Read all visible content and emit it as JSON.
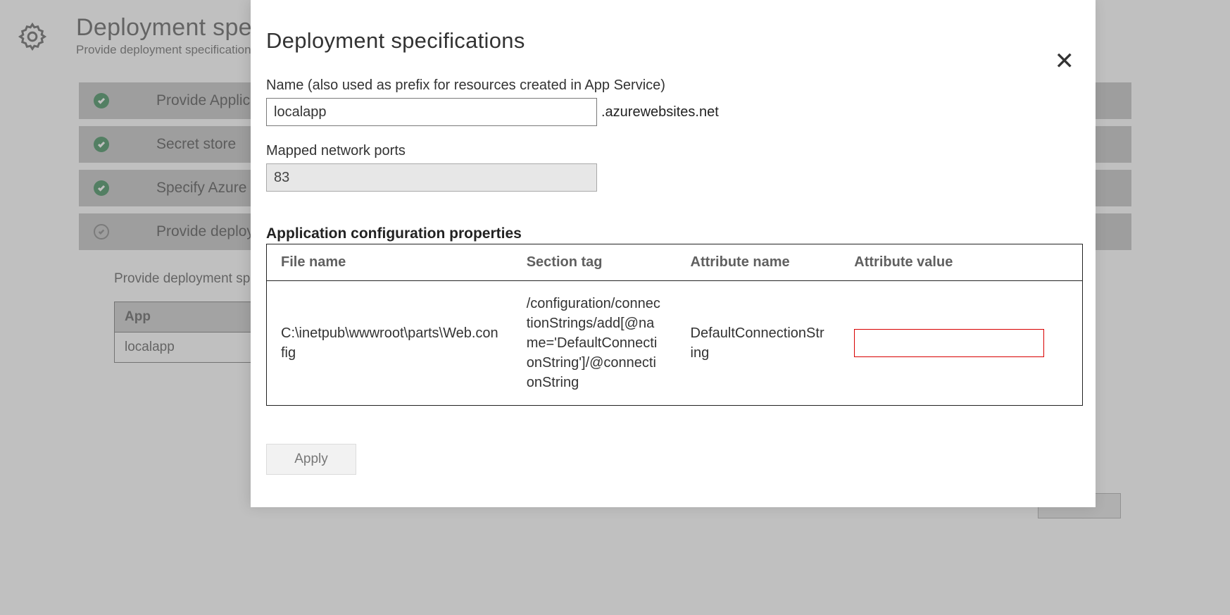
{
  "background": {
    "title": "Deployment specifications",
    "subtitle": "Provide deployment specifications",
    "steps": [
      {
        "label": "Provide Application",
        "state": "done"
      },
      {
        "label": "Secret store",
        "state": "done"
      },
      {
        "label": "Specify Azure",
        "state": "done"
      },
      {
        "label": "Provide deployment",
        "state": "pending"
      }
    ],
    "step_detail_text": "Provide deployment specifications to generate specs.",
    "apps_table": {
      "header": "App",
      "rows": [
        "localapp"
      ]
    },
    "continue_label": ""
  },
  "modal": {
    "title": "Deployment specifications",
    "name_label": "Name (also used as prefix for resources created in App Service)",
    "name_value": "localapp",
    "name_suffix": ".azurewebsites.net",
    "ports_label": "Mapped network ports",
    "ports_value": "83",
    "props_heading": "Application configuration properties",
    "props_columns": {
      "file": "File name",
      "section": "Section tag",
      "attr_name": "Attribute name",
      "attr_value": "Attribute value"
    },
    "props_rows": [
      {
        "file": "C:\\inetpub\\wwwroot\\parts\\Web.config",
        "section": "/configuration/connectionStrings/add[@name='DefaultConnectionString']/@connectionString",
        "attr_name": "DefaultConnectionString",
        "attr_value": ""
      }
    ],
    "apply_label": "Apply"
  }
}
